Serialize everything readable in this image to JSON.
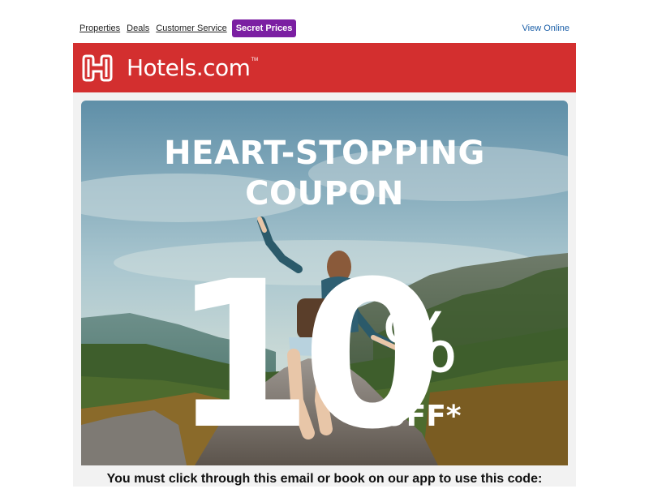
{
  "nav": {
    "links": [
      "Properties",
      "Deals",
      "Customer Service"
    ],
    "secret_prices": "Secret Prices",
    "view_online": "View Online"
  },
  "brand": {
    "name": "Hotels.com",
    "trademark": "TM",
    "color": "#d32f2f"
  },
  "hero": {
    "title_line1": "HEART-STOPPING",
    "title_line2": "COUPON",
    "discount_number": "10",
    "discount_symbol": "%",
    "discount_suffix": "OFF*"
  },
  "instruction": "You must click through this email or book on our app to use this code:",
  "colors": {
    "secret_prices_bg": "#7b1fa2",
    "link_blue": "#1b5fa8"
  }
}
